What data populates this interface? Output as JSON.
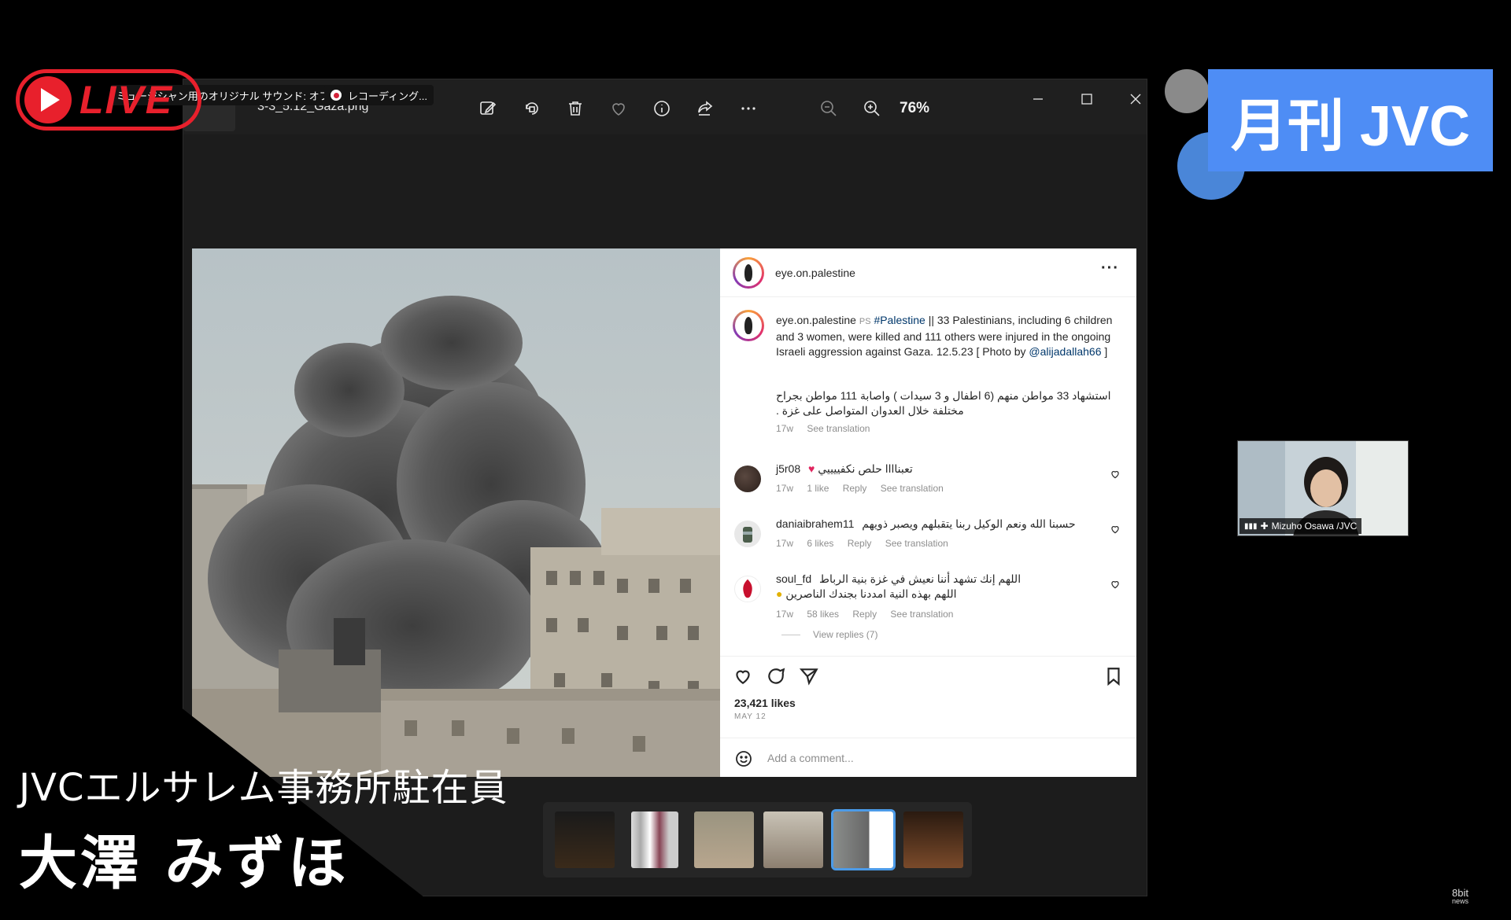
{
  "stream": {
    "live_label": "LIVE",
    "audio_pill": "ミュージシャン用のオリジナル サウンド: オフ",
    "recording_pill": "レコーディング..."
  },
  "viewer": {
    "file_name": "3-3_5.12_Gaza.png",
    "zoom": "76%",
    "toolbar_icons": [
      "edit-icon",
      "rotate-icon",
      "delete-icon",
      "favorite-icon",
      "info-icon",
      "share-icon",
      "more-icon",
      "zoom-out-icon",
      "zoom-in-icon"
    ]
  },
  "post": {
    "username": "eye.on.palestine",
    "caption_user": "eye.on.palestine",
    "caption_prefix": "PS",
    "caption_hashtag": "#Palestine",
    "caption_text": " || 33 Palestinians, including 6 children and 3 women, were killed and 111 others were injured in the ongoing Israeli aggression against Gaza. 12.5.23 [ Photo by ",
    "caption_mention": "@alijadallah66",
    "caption_end": " ]",
    "caption_arabic": "استشهاد 33 مواطن منهم (6 اطفال و 3 سيدات ) واصابة 111 مواطن بجراح مختلفة خلال العدوان المتواصل على غزة .",
    "caption_meta_time": "17w",
    "caption_meta_translate": "See translation",
    "comments": [
      {
        "user": "j5r08",
        "text": "تعبناااا حلص نكفييييي",
        "time": "17w",
        "likes": "1 like",
        "reply": "Reply",
        "translate": "See translation"
      },
      {
        "user": "daniaibrahem11",
        "text": "حسبنا الله ونعم الوكيل ربنا يتقبلهم ويصبر ذويهم",
        "time": "17w",
        "likes": "6 likes",
        "reply": "Reply",
        "translate": "See translation"
      },
      {
        "user": "soul_fd",
        "text": "اللهم إنك تشهد أننا نعيش في غزة بنية الرباط",
        "text2": "اللهم بهذه النية امددنا بجندك الناصرين",
        "time": "17w",
        "likes": "58 likes",
        "reply": "Reply",
        "translate": "See translation"
      }
    ],
    "view_replies": "View replies (7)",
    "likes": "23,421 likes",
    "date": "MAY 12",
    "add_comment_placeholder": "Add a comment..."
  },
  "overlay": {
    "title": "JVCエルサレム事務所駐在員",
    "name": "大澤 みずほ",
    "jvc_badge": "月刊 JVC",
    "participant_name": "Mizuho Osawa /JVC",
    "watermark_line1": "8bit",
    "watermark_line2": "news"
  },
  "colors": {
    "live_red": "#e8202c",
    "jvc_blue": "#4e8df5",
    "link_blue": "#00376b",
    "select_blue": "#4c9be8"
  }
}
